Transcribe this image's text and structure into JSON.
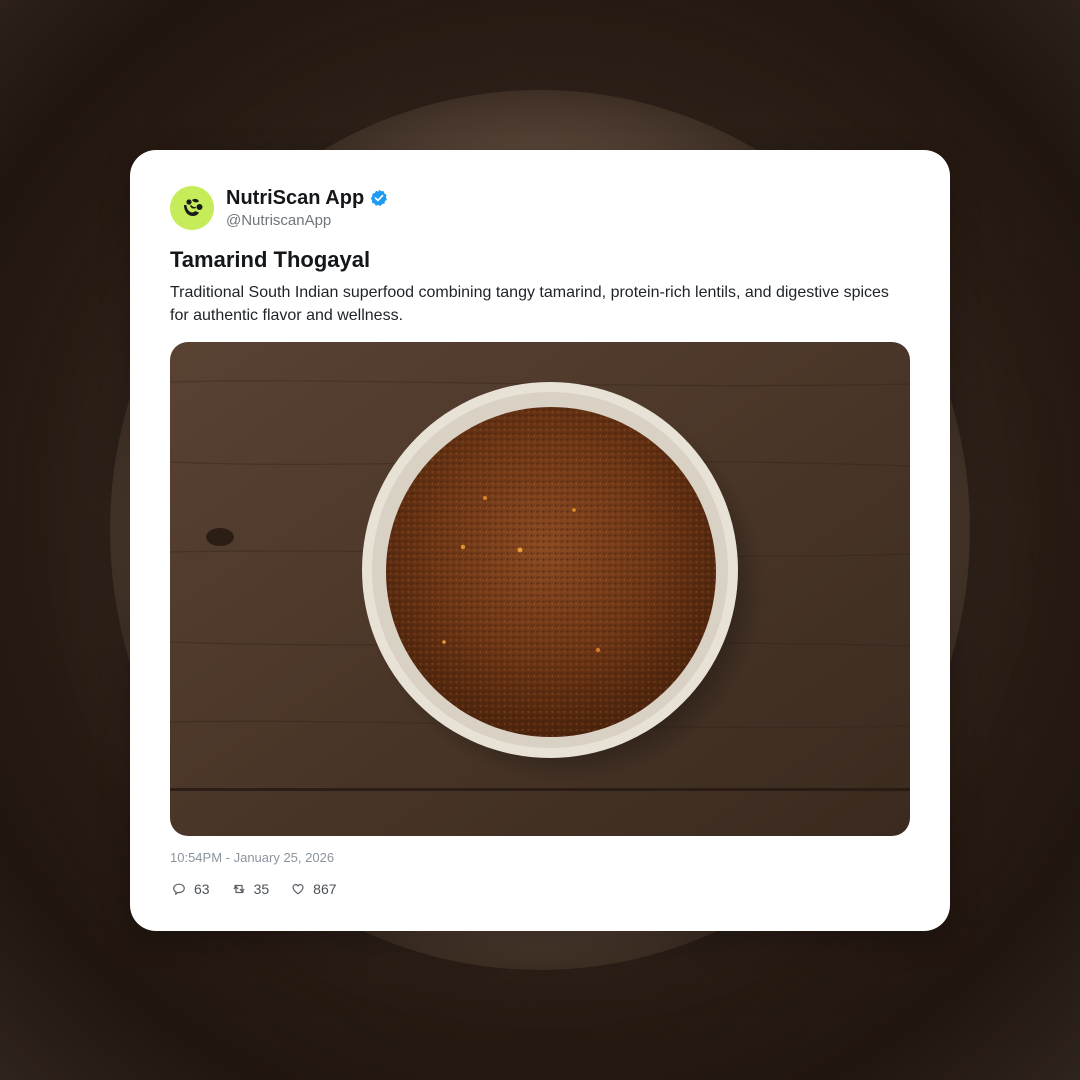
{
  "post": {
    "author": {
      "display_name": "NutriScan App",
      "handle": "@NutriscanApp",
      "verified": true,
      "avatar_icon": "nutriscan-logo-icon",
      "avatar_color": "#c6ec5a"
    },
    "title": "Tamarind Thogayal",
    "description": "Traditional South Indian superfood combining tangy tamarind, protein-rich lentils, and digestive spices for authentic flavor and wellness.",
    "media": {
      "type": "photo",
      "subject_icon": "spice-bowl-photo"
    },
    "timestamp": "10:54PM - January 25, 2026",
    "stats": {
      "replies": "63",
      "retweets": "35",
      "likes": "867"
    }
  },
  "colors": {
    "verified": "#1d9bf0",
    "text_primary": "#14171a",
    "text_secondary": "#6e767d"
  }
}
